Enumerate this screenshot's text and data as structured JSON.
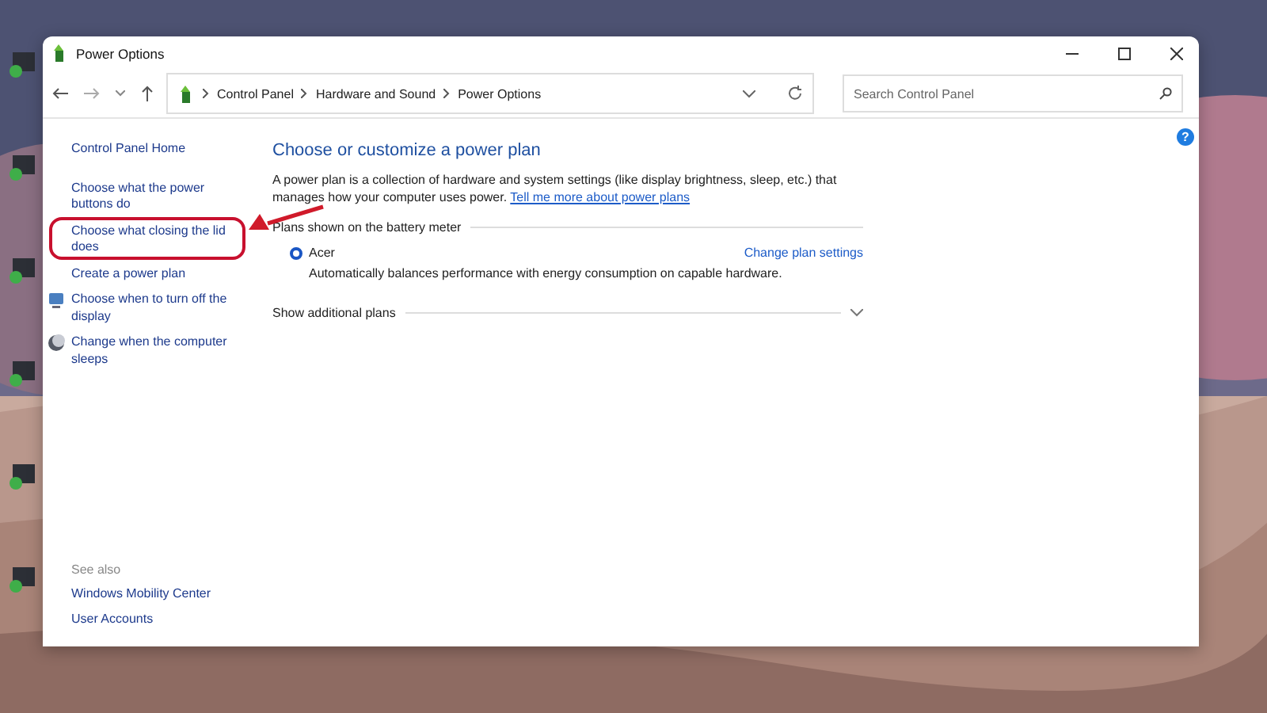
{
  "window": {
    "title": "Power Options"
  },
  "address_bar": {
    "breadcrumbs": [
      "Control Panel",
      "Hardware and Sound",
      "Power Options"
    ]
  },
  "search": {
    "placeholder": "Search Control Panel"
  },
  "sidebar": {
    "home": "Control Panel Home",
    "tasks": [
      {
        "label": "Choose what the power buttons do",
        "kind": "plain",
        "annotated": false
      },
      {
        "label": "Choose what closing the lid does",
        "kind": "plain",
        "annotated": true
      },
      {
        "label": "Create a power plan",
        "kind": "plain",
        "annotated": false
      },
      {
        "label": "Choose when to turn off the display",
        "kind": "display",
        "annotated": false
      },
      {
        "label": "Change when the computer sleeps",
        "kind": "sleep",
        "annotated": false
      }
    ],
    "see_also": {
      "label": "See also",
      "links": [
        "Windows Mobility Center",
        "User Accounts"
      ]
    }
  },
  "main": {
    "heading": "Choose or customize a power plan",
    "intro": "A power plan is a collection of hardware and system settings (like display brightness, sleep, etc.) that manages how your computer uses power.",
    "intro_link": "Tell me more about power plans",
    "section": "Plans shown on the battery meter",
    "plans": [
      {
        "name": "Acer",
        "selected": true,
        "link": "Change plan settings",
        "description": "Automatically balances performance with energy consumption on capable hardware."
      }
    ],
    "additional": {
      "label": "Show additional plans",
      "expanded": false
    }
  },
  "help_button": "?"
}
